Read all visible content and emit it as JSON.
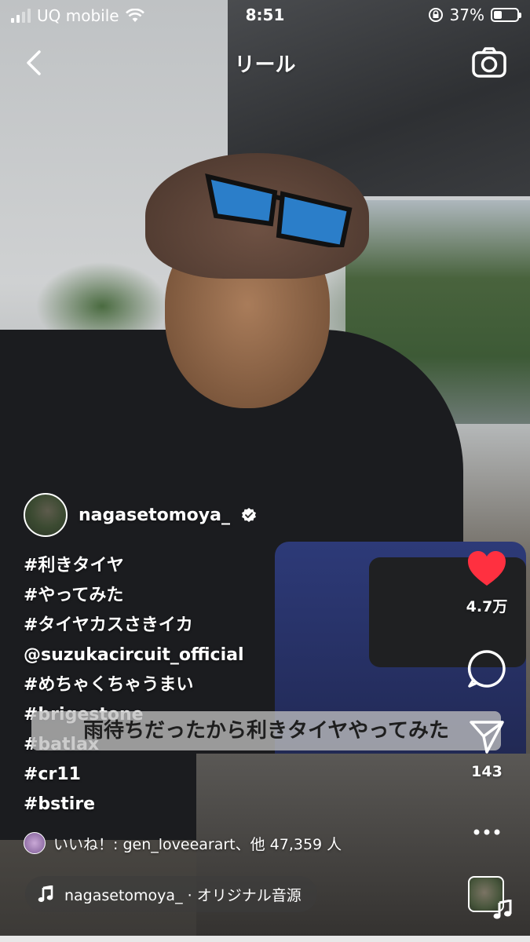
{
  "status_bar": {
    "carrier": "UQ mobile",
    "time": "8:51",
    "battery_percent": "37%",
    "battery_level": 0.37
  },
  "header": {
    "title": "リール"
  },
  "post": {
    "username": "nagasetomoya_",
    "verified": true,
    "caption_lines": [
      "#利きタイヤ",
      "#やってみた",
      "#タイヤカスさきイカ",
      "@suzukacircuit_official",
      "#めちゃくちゃうまい",
      "#brigestone",
      "#batlax",
      "#cr11",
      "#bstire"
    ],
    "subtitle": "雨待ちだったから利きタイヤやってみた",
    "likes_text": "いいね！: gen_loveearart、他 47,359 人",
    "audio": "nagasetomoya_ · オリジナル音源"
  },
  "actions": {
    "like_count": "4.7万",
    "share_count": "143"
  },
  "colors": {
    "like": "#ff3040",
    "text": "#ffffff"
  },
  "icons": [
    "back-icon",
    "camera-icon",
    "verified-icon",
    "heart-icon",
    "comment-icon",
    "share-icon",
    "more-icon",
    "music-note-icon"
  ]
}
